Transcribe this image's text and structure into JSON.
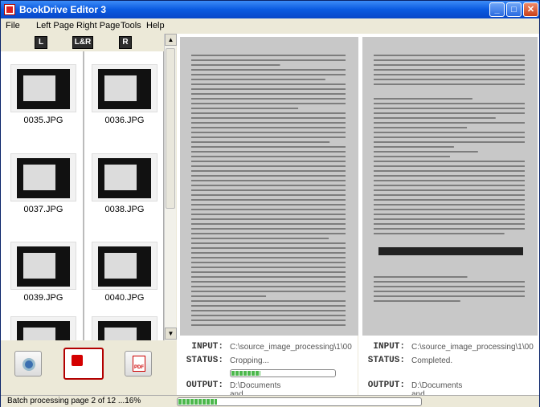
{
  "window": {
    "title": "BookDrive Editor 3",
    "minimize": "_",
    "maximize": "□",
    "close": "✕"
  },
  "menu": [
    "File",
    "Left Page",
    "Right Page",
    "Tools",
    "Help"
  ],
  "page_tags": {
    "left": "L",
    "both": "L&R",
    "right": "R"
  },
  "thumbnails": [
    {
      "label": "0035.JPG"
    },
    {
      "label": "0036.JPG"
    },
    {
      "label": "0037.JPG"
    },
    {
      "label": "0038.JPG"
    },
    {
      "label": "0039.JPG"
    },
    {
      "label": "0040.JPG"
    }
  ],
  "left_page": {
    "input_key": "INPUT:",
    "input_value": "C:\\source_image_processing\\1\\00",
    "status_key": "STATUS:",
    "status_value": "Cropping...",
    "progress": 0.28,
    "output_key": "OUTPUT:",
    "output_value": "D:\\Documents and"
  },
  "right_page": {
    "input_key": "INPUT:",
    "input_value": "C:\\source_image_processing\\1\\00",
    "status_key": "STATUS:",
    "status_value": "Completed.",
    "output_key": "OUTPUT:",
    "output_value": "D:\\Documents and"
  },
  "statusbar": {
    "text": "Batch processing  page 2 of 12 ...16%",
    "progress": 0.16
  },
  "colors": {
    "stop": "#d40000",
    "progress": "#4cb84c",
    "titlebar": "#0a5ae0"
  }
}
